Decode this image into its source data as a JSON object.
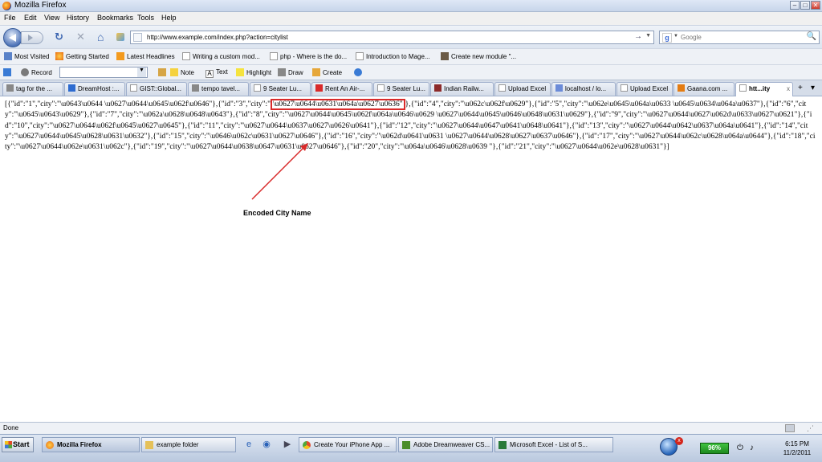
{
  "window": {
    "title": "Mozilla Firefox",
    "minimize_glyph": "–",
    "maximize_glyph": "□",
    "close_glyph": "✕"
  },
  "menu": {
    "items": [
      "File",
      "Edit",
      "View",
      "History",
      "Bookmarks",
      "Tools",
      "Help"
    ]
  },
  "navigation": {
    "url": "http://www.example.com/index.php?action=citylist",
    "search_placeholder": "Google",
    "reload_glyph": "↻",
    "stop_glyph": "✕",
    "home_glyph": "⌂",
    "go_glyph": "→",
    "dropdown_glyph": "▼",
    "search_glyph": "🔍"
  },
  "bookmarks": {
    "items": [
      "Most Visited",
      "Getting Started",
      "Latest Headlines",
      "Writing a custom mod...",
      "php - Where is the do...",
      "Introduction to Mage...",
      "Create new module \"..."
    ]
  },
  "toolbar": {
    "record_label": "Record",
    "note_label": "Note",
    "text_label": "Text",
    "highlight_label": "Highlight",
    "draw_label": "Draw",
    "create_label": "Create"
  },
  "tabs": {
    "items": [
      "tag for the ...",
      "DreamHost :...",
      "GIST::Global...",
      "tempo tavel...",
      "9 Seater Lu...",
      "Rent An Air-...",
      "9 Seater Lu...",
      "Indian Railw...",
      "Upload Excel",
      "localhost / lo...",
      "Upload Excel",
      "Gaana.com ...",
      "htt...ity"
    ],
    "close_glyph": "x",
    "list_glyph": "▾"
  },
  "content": {
    "json_before": "[{\"id\":\"1\",\"city\":\"\\u0643\\u0644 \\u0627\\u0644\\u0645\\u062f\\u0646\"},{\"id\":\"3\",\"city\":\"",
    "json_highlight": "\\u0627\\u0644\\u0631\\u064a\\u0627\\u0636\"",
    "json_after": "},{\"id\":\"4\",\"city\":\"\\u062c\\u062f\\u0629\"},{\"id\":\"5\",\"city\":\"\\u062e\\u0645\\u064a\\u0633 \\u0645\\u0634\\u064a\\u0637\"},{\"id\":\"6\",\"city\":\"\\u0645\\u0643\\u0629\"},{\"id\":\"7\",\"city\":\"\\u062a\\u0628\\u0648\\u0643\"},{\"id\":\"8\",\"city\":\"\\u0627\\u0644\\u0645\\u062f\\u064a\\u0646\\u0629 \\u0627\\u0644\\u0645\\u0646\\u0648\\u0631\\u0629\"},{\"id\":\"9\",\"city\":\"\\u0627\\u0644\\u0627\\u062d\\u0633\\u0627\\u0621\"},{\"id\":\"10\",\"city\":\"\\u0627\\u0644\\u062f\\u0645\\u0627\\u0645\"},{\"id\":\"11\",\"city\":\"\\u0627\\u0644\\u0637\\u0627\\u0626\\u0641\"},{\"id\":\"12\",\"city\":\"\\u0627\\u0644\\u0647\\u0641\\u0648\\u0641\"},{\"id\":\"13\",\"city\":\"\\u0627\\u0644\\u0642\\u0637\\u064a\\u0641\"},{\"id\":\"14\",\"city\":\"\\u0627\\u0644\\u0645\\u0628\\u0631\\u0632\"},{\"id\":\"15\",\"city\":\"\\u0646\\u062c\\u0631\\u0627\\u0646\"},{\"id\":\"16\",\"city\":\"\\u062d\\u0641\\u0631 \\u0627\\u0644\\u0628\\u0627\\u0637\\u0646\"},{\"id\":\"17\",\"city\":\"\\u0627\\u0644\\u062c\\u0628\\u064a\\u0644\"},{\"id\":\"18\",\"city\":\"\\u0627\\u0644\\u062e\\u0631\\u062c\"},{\"id\":\"19\",\"city\":\"\\u0627\\u0644\\u0638\\u0647\\u0631\\u0627\\u0646\"},{\"id\":\"20\",\"city\":\"\\u064a\\u0646\\u0628\\u0639 \"},{\"id\":\"21\",\"city\":\"\\u0627\\u0644\\u062e\\u0628\\u0631\"}]",
    "annotation_label": "Encoded City Name",
    "annotation_color": "#d92a2a"
  },
  "status": {
    "text": "Done"
  },
  "taskbar": {
    "start_label": "Start",
    "tasks": [
      "Mozilla Firefox",
      "example folder",
      "Create Your iPhone App ...",
      "Adobe Dreamweaver CS...",
      "Microsoft Excel - List of S..."
    ],
    "battery": "96%",
    "time": "6:15 PM",
    "date": "11/2/2011",
    "av_badge": "x"
  }
}
